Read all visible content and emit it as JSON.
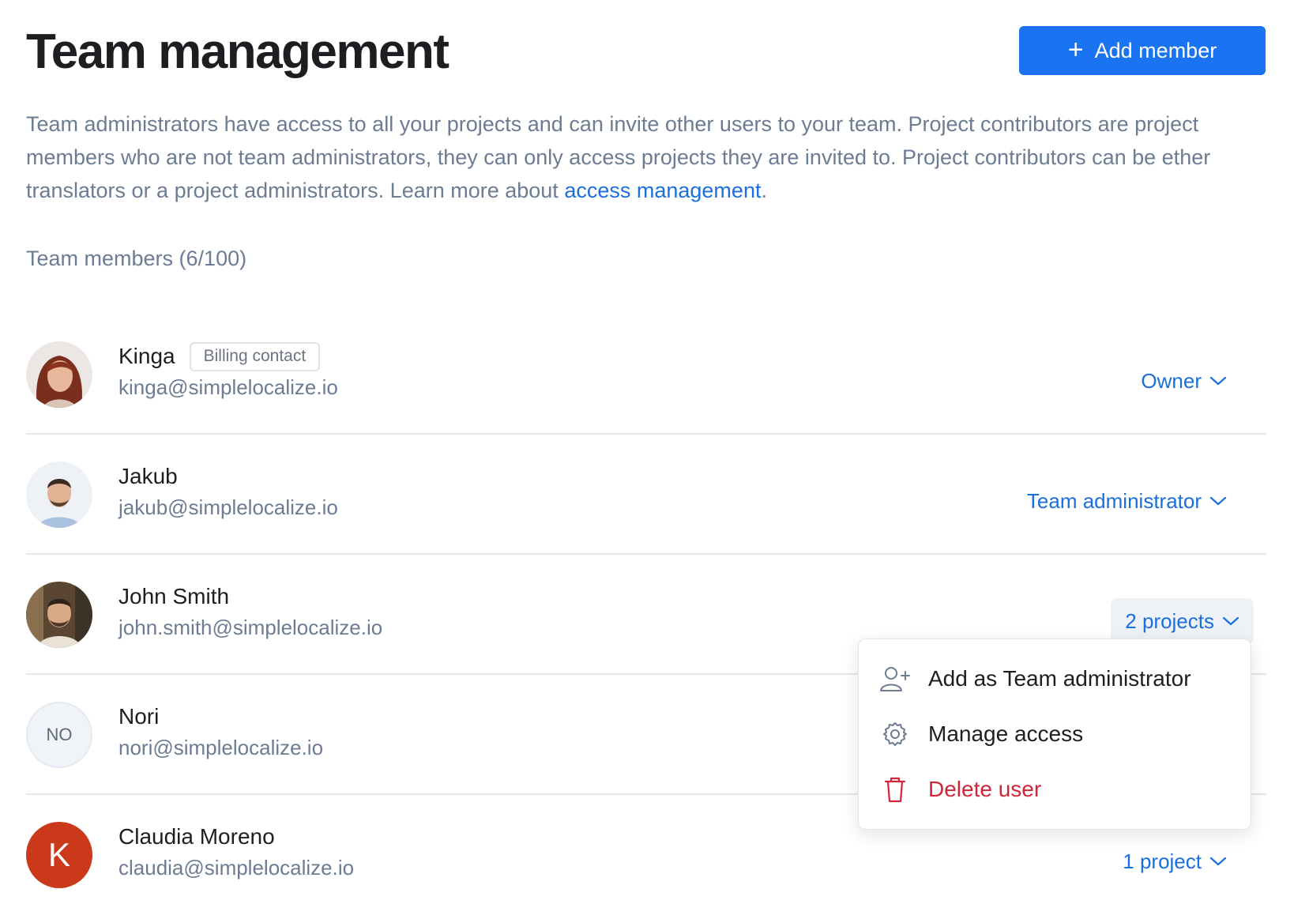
{
  "header": {
    "title": "Team management",
    "add_member_label": "Add member"
  },
  "description": {
    "text": "Team administrators have access to all your projects and can invite other users to your team. Project contributors are project members who are not team administrators, they can only access projects they are invited to. Project contributors can be ether translators or a project administrators. Learn more about ",
    "link_text": "access management",
    "suffix": "."
  },
  "members_count_label": "Team members (6/100)",
  "members": [
    {
      "name": "Kinga",
      "badge": "Billing contact",
      "email": "kinga@simplelocalize.io",
      "role": "Owner",
      "avatar": "photo"
    },
    {
      "name": "Jakub",
      "email": "jakub@simplelocalize.io",
      "role": "Team administrator",
      "avatar": "photo"
    },
    {
      "name": "John Smith",
      "email": "john.smith@simplelocalize.io",
      "role": "2 projects",
      "avatar": "photo",
      "menu_open": true
    },
    {
      "name": "Nori",
      "email": "nori@simplelocalize.io",
      "role": "",
      "avatar_initials": "NO"
    },
    {
      "name": "Claudia Moreno",
      "email": "claudia@simplelocalize.io",
      "role": "1 project",
      "avatar_letter": "K"
    }
  ],
  "dropdown_menu": {
    "items": [
      {
        "label": "Add as Team administrator",
        "icon": "user-plus-icon"
      },
      {
        "label": "Manage access",
        "icon": "gear-icon"
      },
      {
        "label": "Delete user",
        "icon": "trash-icon",
        "danger": true
      }
    ]
  },
  "colors": {
    "accent": "#1a73f0",
    "danger": "#d1253a",
    "muted_text": "#6b7c93"
  }
}
